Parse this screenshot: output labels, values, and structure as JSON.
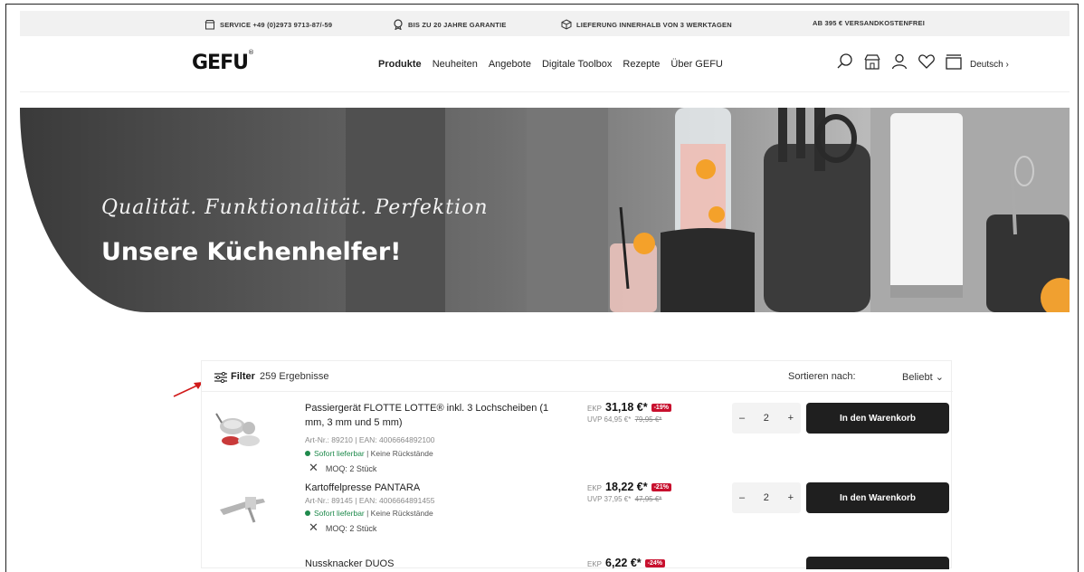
{
  "topbar": {
    "service": "SERVICE +49 (0)2973 9713-87/-59",
    "guarantee": "BIS ZU 20 JAHRE GARANTIE",
    "delivery": "LIEFERUNG INNERHALB VON 3 WERKTAGEN",
    "shipping": "AB 395 € VERSANDKOSTENFREI"
  },
  "header": {
    "logo": "GEFU",
    "logo_mark": "®",
    "nav": [
      "Produkte",
      "Neuheiten",
      "Angebote",
      "Digitale Toolbox",
      "Rezepte",
      "Über GEFU"
    ],
    "language": "Deutsch ›",
    "icons": [
      "search-icon",
      "store-icon",
      "user-icon",
      "heart-icon",
      "cart-icon"
    ]
  },
  "hero": {
    "tagline": "Qualität. Funktionalität. Perfektion",
    "title": "Unsere Küchenhelfer!"
  },
  "listing": {
    "filter_label": "Filter",
    "results": "259 Ergebnisse",
    "sort_label": "Sortieren nach:",
    "sort_value": "Beliebt ⌄",
    "products": [
      {
        "name": "Passiergerät FLOTTE LOTTE® inkl. 3 Lochscheiben (1 mm, 3 mm und 5 mm)",
        "meta": "Art-Nr.: 89210 | EAN: 4006664892100",
        "stock_ok": "Sofort lieferbar",
        "stock_rest": " | Keine Rückstände",
        "moq": "MOQ: 2 Stück",
        "ekp_label": "EKP",
        "ekp": "31,18 €*",
        "discount": "-19%",
        "uvp_label": "UVP",
        "uvp": "64,95 €*",
        "uvp_old": "79,95 €*",
        "qty": "2",
        "cart": "In den Warenkorb"
      },
      {
        "name": "Kartoffelpresse PANTARA",
        "meta": "Art-Nr.: 89145 | EAN: 4006664891455",
        "stock_ok": "Sofort lieferbar",
        "stock_rest": " | Keine Rückstände",
        "moq": "MOQ: 2 Stück",
        "ekp_label": "EKP",
        "ekp": "18,22 €*",
        "discount": "-21%",
        "uvp_label": "UVP",
        "uvp": "37,95 €*",
        "uvp_old": "47,95 €*",
        "qty": "2",
        "cart": "In den Warenkorb"
      },
      {
        "name": "Nussknacker DUOS",
        "ekp_label": "EKP",
        "ekp": "6,22 €*",
        "discount": "-24%"
      }
    ]
  },
  "colors": {
    "accent_dark": "#1f1f1f",
    "discount_red": "#c8102e",
    "stock_green": "#1f8a4c"
  }
}
